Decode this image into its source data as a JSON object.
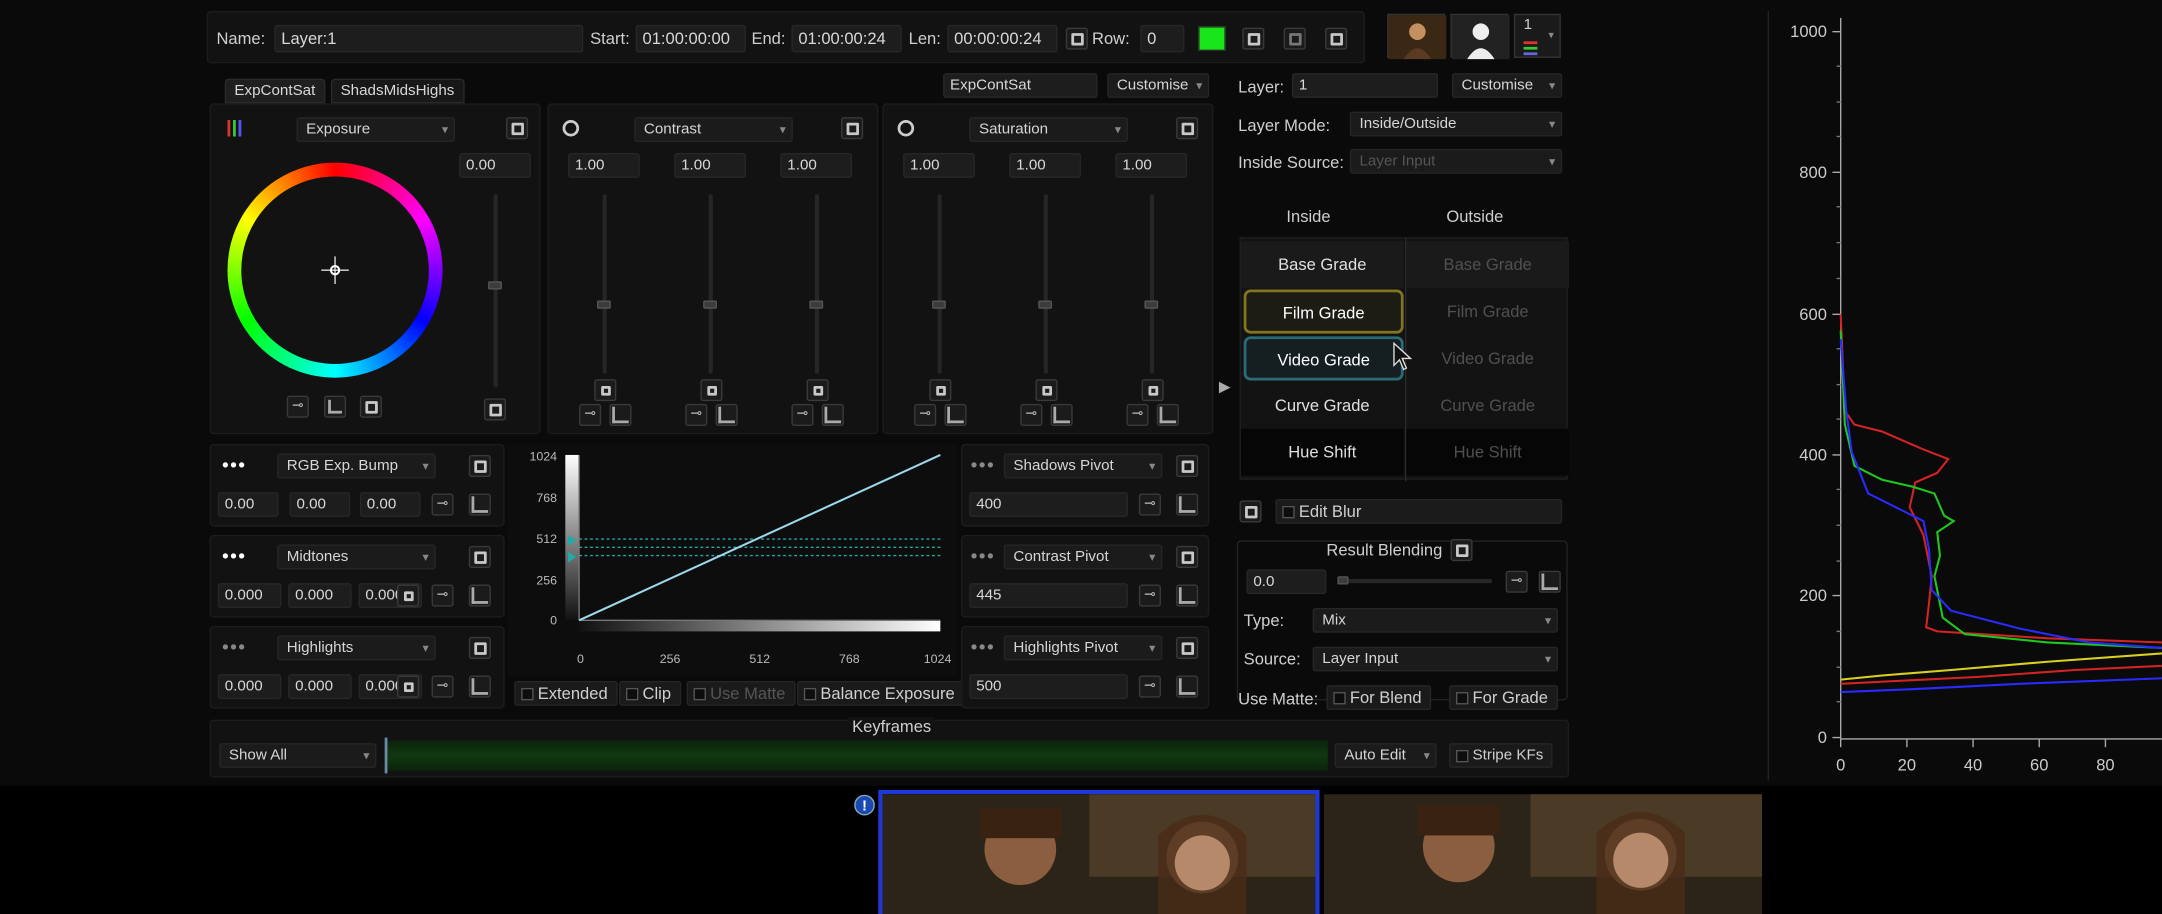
{
  "header": {
    "name_label": "Name:",
    "name_value": "Layer:1",
    "start_label": "Start:",
    "start_value": "01:00:00:00",
    "end_label": "End:",
    "end_value": "01:00:00:24",
    "len_label": "Len:",
    "len_value": "00:00:00:24",
    "row_label": "Row:",
    "row_value": "0",
    "layer_count": "1",
    "swatch_color": "#19e619"
  },
  "tabs": [
    {
      "label": "ExpContSat"
    },
    {
      "label": "ShadsMidsHighs"
    }
  ],
  "preset": {
    "name": "ExpContSat",
    "customise": "Customise"
  },
  "exposure": {
    "dropdown": "Exposure",
    "value": "0.00"
  },
  "contrast": {
    "dropdown": "Contrast",
    "values": [
      "1.00",
      "1.00",
      "1.00"
    ]
  },
  "saturation": {
    "dropdown": "Saturation",
    "values": [
      "1.00",
      "1.00",
      "1.00"
    ]
  },
  "rows": [
    {
      "dropdown": "RGB Exp. Bump",
      "values": [
        "0.00",
        "0.00",
        "0.00"
      ]
    },
    {
      "dropdown": "Midtones",
      "values": [
        "0.000",
        "0.000",
        "0.000"
      ]
    },
    {
      "dropdown": "Highlights",
      "values": [
        "0.000",
        "0.000",
        "0.000"
      ]
    }
  ],
  "curve": {
    "y_ticks": [
      "1024",
      "768",
      "512",
      "256",
      "0"
    ],
    "x_ticks": [
      "0",
      "256",
      "512",
      "768",
      "1024"
    ]
  },
  "pivots": [
    {
      "dropdown": "Shadows Pivot",
      "value": "400"
    },
    {
      "dropdown": "Contrast Pivot",
      "value": "445"
    },
    {
      "dropdown": "Highlights Pivot",
      "value": "500"
    }
  ],
  "options": {
    "extended": "Extended",
    "clip": "Clip",
    "use_matte": "Use Matte",
    "balance_exposure": "Balance Exposure"
  },
  "keyframes": {
    "title": "Keyframes",
    "show": "Show All",
    "auto_edit": "Auto Edit",
    "stripe_kfs": "Stripe KFs"
  },
  "layer_panel": {
    "layer_label": "Layer:",
    "layer_value": "1",
    "customise": "Customise",
    "mode_label": "Layer Mode:",
    "mode_value": "Inside/Outside",
    "source_label": "Inside Source:",
    "source_value": "Layer Input",
    "inside_header": "Inside",
    "outside_header": "Outside",
    "grades": [
      "Base Grade",
      "Film Grade",
      "Video Grade",
      "Curve Grade",
      "Hue Shift"
    ],
    "edit_blur": "Edit Blur",
    "result_blending": "Result Blending",
    "blend_value": "0.0",
    "type_label": "Type:",
    "type_value": "Mix",
    "src_label": "Source:",
    "src_value": "Layer Input",
    "use_matte_label": "Use Matte:",
    "for_blend": "For Blend",
    "for_grade": "For Grade"
  },
  "histogram": {
    "y_ticks": [
      "1000",
      "800",
      "600",
      "400",
      "200",
      "0"
    ],
    "x_ticks": [
      "0",
      "20",
      "40",
      "60",
      "80"
    ]
  },
  "timeline": {
    "info_icon": "info-icon"
  }
}
